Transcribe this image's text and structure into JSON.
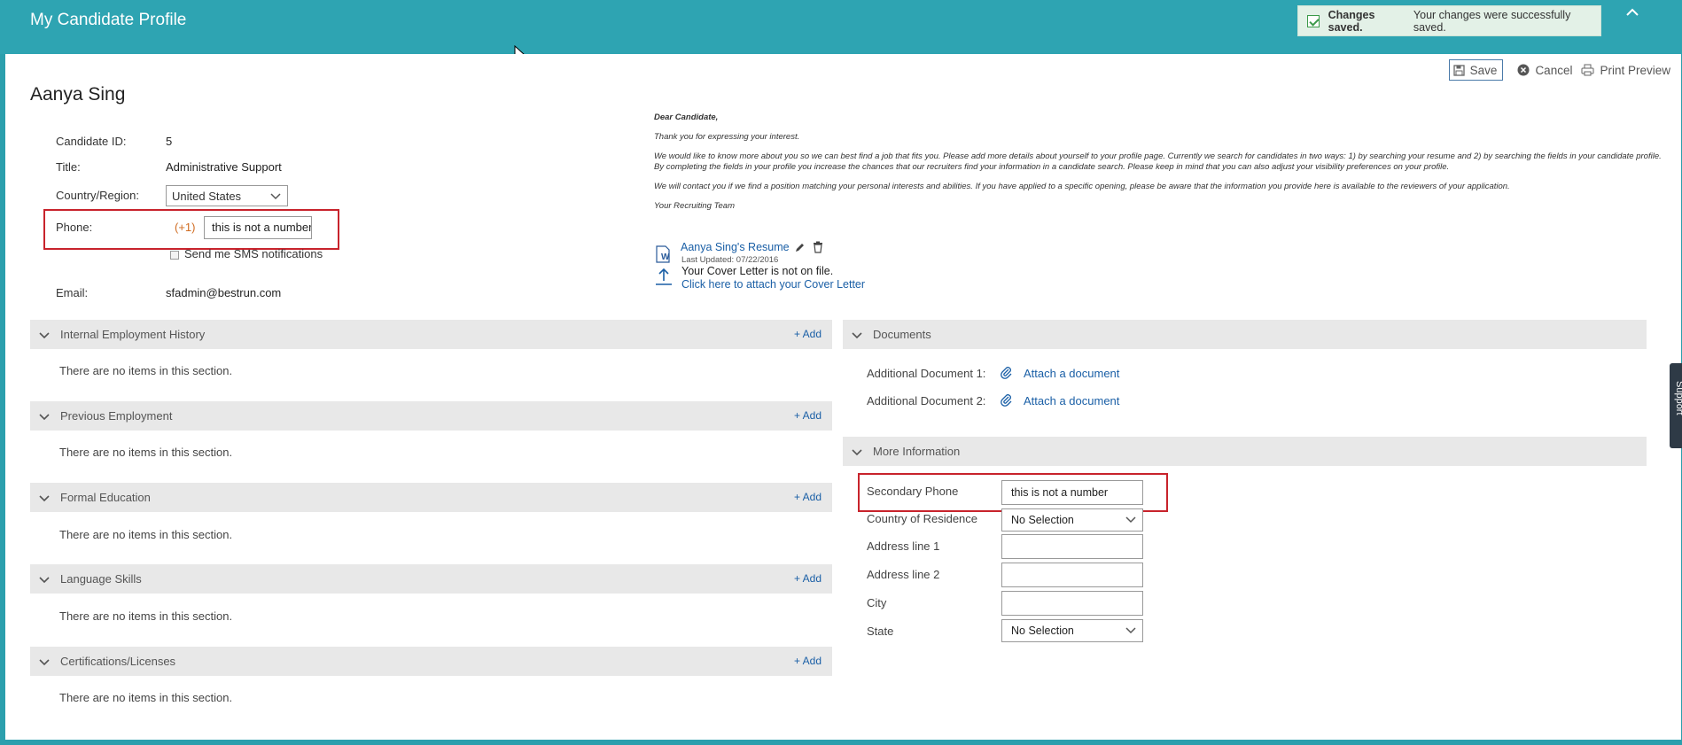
{
  "header": {
    "title": "My Candidate Profile"
  },
  "toast": {
    "bold": "Changes saved.",
    "text": "Your changes were successfully saved."
  },
  "toolbar": {
    "save_label": "Save",
    "cancel_label": "Cancel",
    "print_label": "Print Preview"
  },
  "candidate": {
    "name": "Aanya Sing",
    "id_label": "Candidate ID:",
    "id_value": "5",
    "title_label": "Title:",
    "title_value": "Administrative Support",
    "country_label": "Country/Region:",
    "country_value": "United States",
    "phone_label": "Phone:",
    "phone_code": "(+1)",
    "phone_value": "this is not a number",
    "sms_label": "Send me SMS notifications",
    "email_label": "Email:",
    "email_value": "sfadmin@bestrun.com"
  },
  "letter": {
    "greeting": "Dear Candidate,",
    "p1": "Thank you for expressing your interest.",
    "p2": "We would like to know more about you so we can best find a job that fits you. Please add more details about yourself to your profile page. Currently we search for candidates in two ways: 1) by searching your resume and 2) by searching the fields in your candidate profile. By completing the fields in your profile you increase the chances that our recruiters find your information in a candidate search. Please keep in mind that you can also adjust your visibility preferences on your profile.",
    "p3": "We will contact you if we find a position matching your personal interests and abilities. If you have applied to a specific opening, please be aware that the information you provide here is available to the reviewers of your application.",
    "signoff": "Your Recruiting Team"
  },
  "resume": {
    "link": "Aanya Sing's Resume",
    "updated": "Last Updated: 07/22/2016",
    "cover_status": "Your Cover Letter is not on file.",
    "cover_link": "Click here to attach your Cover Letter"
  },
  "sections_left": [
    {
      "title": "Internal Employment History",
      "add": "+ Add",
      "empty": "There are no items in this section."
    },
    {
      "title": "Previous Employment",
      "add": "+ Add",
      "empty": "There are no items in this section."
    },
    {
      "title": "Formal Education",
      "add": "+ Add",
      "empty": "There are no items in this section."
    },
    {
      "title": "Language Skills",
      "add": "+ Add",
      "empty": "There are no items in this section."
    },
    {
      "title": "Certifications/Licenses",
      "add": "+ Add",
      "empty": "There are no items in this section."
    }
  ],
  "documents": {
    "title": "Documents",
    "doc1_label": "Additional Document 1:",
    "doc1_link": "Attach a document",
    "doc2_label": "Additional Document 2:",
    "doc2_link": "Attach a document"
  },
  "more_info": {
    "title": "More Information",
    "secondary_phone_label": "Secondary Phone",
    "secondary_phone_value": "this is not a number",
    "residence_label": "Country of Residence",
    "residence_value": "No Selection",
    "address1_label": "Address line 1",
    "address1_value": "",
    "address2_label": "Address line 2",
    "address2_value": "",
    "city_label": "City",
    "city_value": "",
    "state_label": "State",
    "state_value": "No Selection"
  },
  "support": {
    "label": "Support"
  },
  "colors": {
    "header": "#2ea4b2",
    "link": "#1a5fa6",
    "highlight": "#c8232c"
  }
}
